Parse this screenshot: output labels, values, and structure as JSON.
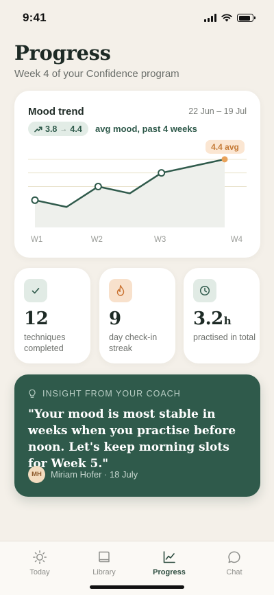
{
  "status_bar": {
    "time": "9:41"
  },
  "header": {
    "title": "Progress",
    "subtitle": "Week 4 of your Confidence program"
  },
  "mood_trend": {
    "title": "Mood trend",
    "date_range": "22 Jun – 19 Jul",
    "pill_from": "3.8",
    "pill_arrow": "→",
    "pill_to": "4.4",
    "caption": "avg mood, past 4 weeks",
    "badge": "4.4 avg"
  },
  "chart_data": {
    "type": "line",
    "categories": [
      "W1",
      "W2",
      "W3",
      "W4"
    ],
    "x": [
      0,
      0.5,
      1,
      1.5,
      2,
      2.5,
      3
    ],
    "series": [
      {
        "values": [
          3.8,
          3.7,
          4.0,
          3.9,
          4.2,
          4.3,
          4.4
        ],
        "markers": [
          true,
          false,
          true,
          false,
          true,
          false,
          true
        ]
      }
    ],
    "ylim": [
      3.4,
      4.6
    ],
    "gridlines": [
      4.4,
      4.2,
      4.0
    ],
    "grid": true,
    "area_fill": true,
    "colors": {
      "line": "#2f5a4b",
      "area": "#eef0ec",
      "highlight": "#e8a25a",
      "grid": "#e9e2cc"
    }
  },
  "stats": [
    {
      "value": "12",
      "unit": "",
      "label": "techniques completed",
      "icon": "check-icon",
      "tone": "green"
    },
    {
      "value": "9",
      "unit": "",
      "label": "day check-in streak",
      "icon": "flame-icon",
      "tone": "orange"
    },
    {
      "value": "3.2",
      "unit": "h",
      "label": "practised in total",
      "icon": "clock-icon",
      "tone": "green"
    }
  ],
  "insight": {
    "heading": "INSIGHT FROM YOUR COACH",
    "quote": "\"Your mood is most stable in weeks when you practise before noon. Let's keep morning slots for Week 5.\"",
    "author_initials": "MH",
    "author": "Miriam Hofer · 18 July"
  },
  "tabs": [
    {
      "label": "Today",
      "icon": "sun-icon",
      "active": false
    },
    {
      "label": "Library",
      "icon": "book-icon",
      "active": false
    },
    {
      "label": "Progress",
      "icon": "chart-icon",
      "active": true
    },
    {
      "label": "Chat",
      "icon": "chat-bubble-icon",
      "active": false
    }
  ],
  "colors": {
    "background": "#f4f0e9",
    "brand": "#2f5a4b",
    "accent": "#e8a25a"
  }
}
